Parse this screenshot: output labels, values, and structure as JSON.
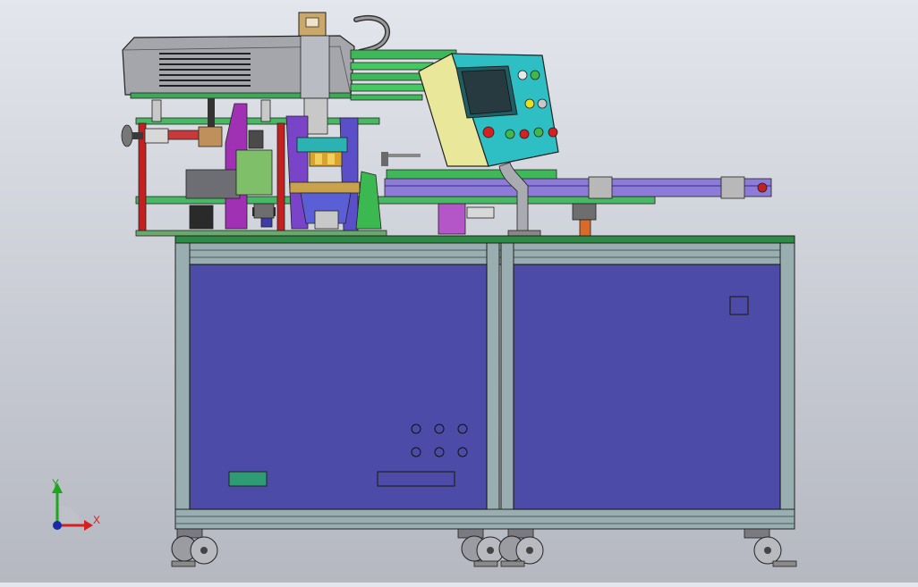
{
  "model_view": {
    "triad": {
      "x_label": "X",
      "y_label": "Y",
      "x_color": "#d42020",
      "y_color": "#1fa51f",
      "origin_color": "#1a2aa8"
    },
    "colors": {
      "background_top": "#e3e6ec",
      "background_bottom": "#b5b8c1",
      "cabinet_panel": "#4c4ca8",
      "frame_profile": "#98aeb0",
      "table_top": "#2e8b45",
      "control_box": "#2dbfc3",
      "control_cover": "#e8e79a",
      "conveyor": "#8c7cd8",
      "cover_hood": "#9ea0a6"
    }
  }
}
